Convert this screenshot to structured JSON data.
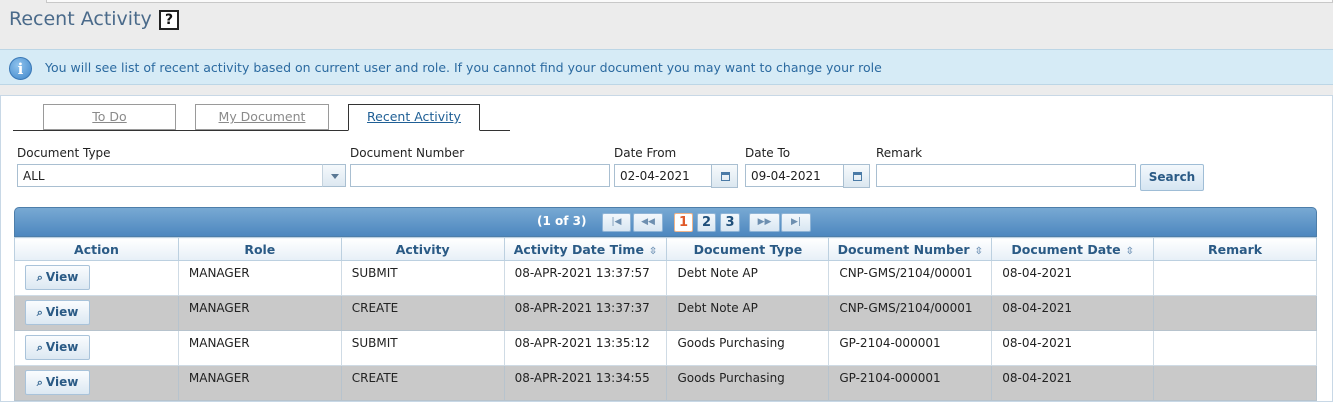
{
  "page": {
    "title": "Recent Activity",
    "help_glyph": "?"
  },
  "info": {
    "icon_glyph": "i",
    "message": "You will see list of recent activity based on current user and role. If you cannot find your document you may want to change your role"
  },
  "tabs": [
    {
      "label": "To Do",
      "active": false
    },
    {
      "label": "My Document",
      "active": false
    },
    {
      "label": "Recent Activity",
      "active": true
    }
  ],
  "filters": {
    "document_type_label": "Document Type",
    "document_type_value": "ALL",
    "document_number_label": "Document Number",
    "document_number_value": "",
    "date_from_label": "Date From",
    "date_from_value": "02-04-2021",
    "date_to_label": "Date To",
    "date_to_value": "09-04-2021",
    "remark_label": "Remark",
    "remark_value": "",
    "search_label": "Search"
  },
  "pager": {
    "info": "(1 of 3)",
    "first": "|◀",
    "prev": "◀◀",
    "next": "▶▶",
    "last": "▶|",
    "pages": [
      "1",
      "2",
      "3"
    ],
    "current_page": "1"
  },
  "table": {
    "columns": [
      "Action",
      "Role",
      "Activity",
      "Activity Date Time",
      "Document Type",
      "Document Number",
      "Document Date",
      "Remark"
    ],
    "sortable_icon": "⇳",
    "view_label": "View",
    "view_icon": "⌕",
    "rows": [
      {
        "role": "MANAGER",
        "activity": "SUBMIT",
        "datetime": "08-APR-2021 13:37:57",
        "doc_type": "Debt Note AP",
        "doc_number": "CNP-GMS/2104/00001",
        "doc_date": "08-04-2021",
        "remark": ""
      },
      {
        "role": "MANAGER",
        "activity": "CREATE",
        "datetime": "08-APR-2021 13:37:37",
        "doc_type": "Debt Note AP",
        "doc_number": "CNP-GMS/2104/00001",
        "doc_date": "08-04-2021",
        "remark": ""
      },
      {
        "role": "MANAGER",
        "activity": "SUBMIT",
        "datetime": "08-APR-2021 13:35:12",
        "doc_type": "Goods Purchasing",
        "doc_number": "GP-2104-000001",
        "doc_date": "08-04-2021",
        "remark": ""
      },
      {
        "role": "MANAGER",
        "activity": "CREATE",
        "datetime": "08-APR-2021 13:34:55",
        "doc_type": "Goods Purchasing",
        "doc_number": "GP-2104-000001",
        "doc_date": "08-04-2021",
        "remark": ""
      }
    ]
  }
}
